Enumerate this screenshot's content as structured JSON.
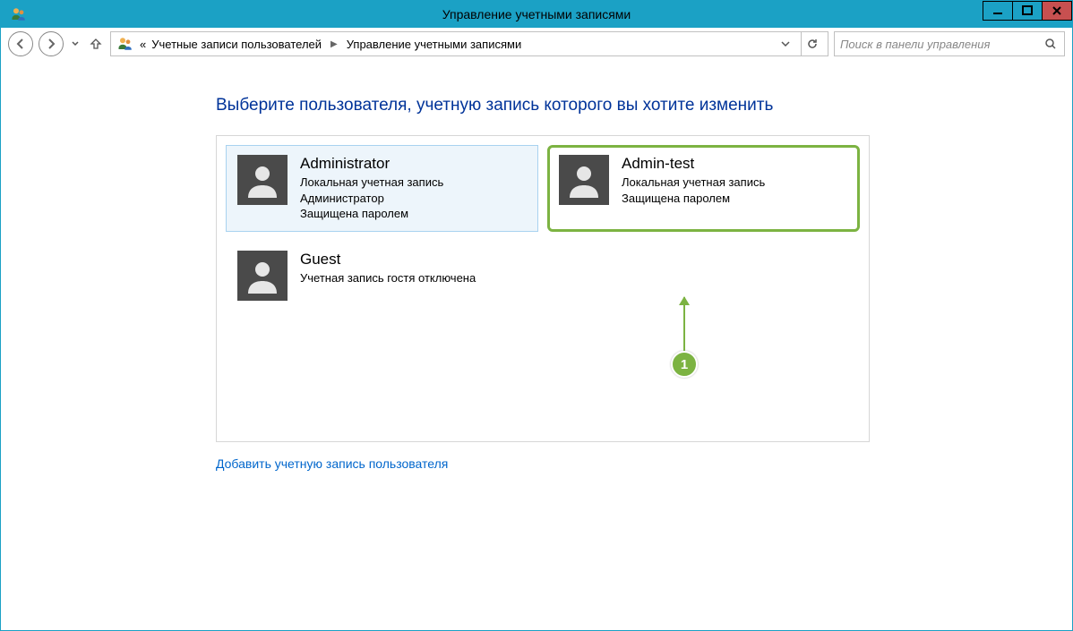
{
  "titlebar": {
    "title": "Управление учетными записями"
  },
  "breadcrumb": {
    "prefix": "«",
    "item1": "Учетные записи пользователей",
    "item2": "Управление учетными записями"
  },
  "search": {
    "placeholder": "Поиск в панели управления"
  },
  "heading": "Выберите пользователя, учетную запись которого вы хотите изменить",
  "users": [
    {
      "name": "Administrator",
      "line1": "Локальная учетная запись",
      "line2": "Администратор",
      "line3": "Защищена паролем"
    },
    {
      "name": "Admin-test",
      "line1": "Локальная учетная запись",
      "line2": "Защищена паролем",
      "line3": ""
    },
    {
      "name": "Guest",
      "line1": "Учетная запись гостя отключена",
      "line2": "",
      "line3": ""
    }
  ],
  "add_user_link": "Добавить учетную запись пользователя",
  "callout": {
    "number": "1"
  }
}
